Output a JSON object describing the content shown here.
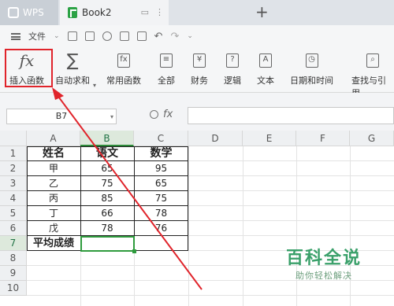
{
  "tabs": {
    "app": "WPS",
    "document": "Book2",
    "new_tab": "+"
  },
  "menubar": {
    "file_label": "文件"
  },
  "ribbon": {
    "insert_function": "插入函数",
    "autosum": "自动求和",
    "common_functions": "常用函数",
    "all": "全部",
    "finance": "财务",
    "logic": "逻辑",
    "text": "文本",
    "datetime": "日期和时间",
    "lookup": "查找与引用"
  },
  "formula_bar": {
    "name_box": "B7",
    "fx": "fx",
    "formula": ""
  },
  "sheet": {
    "columns": [
      "A",
      "B",
      "C",
      "D",
      "E",
      "F",
      "G"
    ],
    "rows": [
      "1",
      "2",
      "3",
      "4",
      "5",
      "6",
      "7",
      "8",
      "9",
      "10"
    ],
    "headers": [
      "姓名",
      "语文",
      "数学"
    ],
    "data": [
      [
        "甲",
        "65",
        "95"
      ],
      [
        "乙",
        "75",
        "65"
      ],
      [
        "丙",
        "85",
        "75"
      ],
      [
        "丁",
        "66",
        "78"
      ],
      [
        "戊",
        "78",
        "76"
      ]
    ],
    "average_label": "平均成绩",
    "selected_cell": "B7"
  },
  "watermark": {
    "title": "百科全说",
    "subtitle": "助你轻松解决"
  },
  "colors": {
    "accent_green": "#2e9b3d",
    "highlight_red": "#e0242b",
    "watermark_green": "#3aa06a"
  }
}
